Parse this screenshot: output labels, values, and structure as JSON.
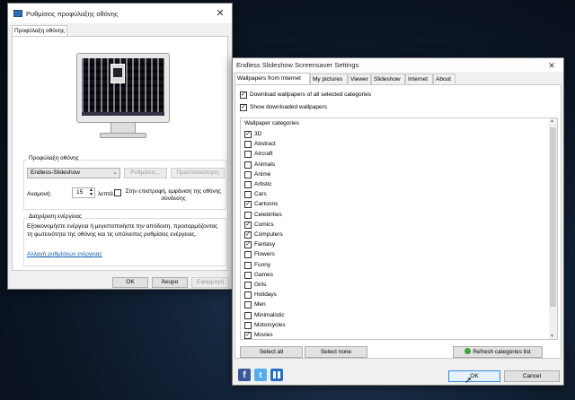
{
  "screensaver_dialog": {
    "title": "Ρυθμίσεις προφύλαξης οθόνης",
    "tab": "Προφύλαξη οθόνης",
    "group_label": "Προφύλαξη οθόνης",
    "selected_screensaver": "Endless-Slideshow",
    "settings_button": "Ρυθμίσεις...",
    "preview_button": "Προεπισκόπηση",
    "wait_label": "Αναμονή:",
    "wait_value": "15",
    "wait_unit": "λεπτά",
    "resume_checkbox_label": "Στην επιστροφή, εμφάνιση της οθόνης σύνδεσης",
    "power_group_label": "Διαχείριση ενέργειας",
    "power_text": "Εξοικονομήστε ενέργεια ή μεγιστοποιήστε την απόδοση, προσαρμόζοντας τη φωτεινότητα της οθόνης και τις υπόλοιπες ρυθμίσεις ενέργειας.",
    "power_link": "Αλλαγή ρυθμίσεων ενέργειας",
    "ok_button": "OK",
    "cancel_button": "Άκυρο",
    "apply_button": "Εφαρμογή"
  },
  "slideshow_dialog": {
    "title": "Endless Slideshow Screensaver Settings",
    "tabs": [
      "Wallpapers from Internet",
      "My pictures",
      "Viewer",
      "Slideshow",
      "Internet",
      "About"
    ],
    "download_all_label": "Download wallpapers of all selected categories",
    "download_all_checked": true,
    "show_downloaded_label": "Show downloaded wallpapers",
    "show_downloaded_checked": true,
    "categories_header": "Wallpaper categories",
    "categories": [
      {
        "name": "3D",
        "checked": true
      },
      {
        "name": "Abstract",
        "checked": false
      },
      {
        "name": "Aircraft",
        "checked": false
      },
      {
        "name": "Animals",
        "checked": false
      },
      {
        "name": "Anime",
        "checked": false
      },
      {
        "name": "Artistic",
        "checked": false
      },
      {
        "name": "Cars",
        "checked": false
      },
      {
        "name": "Cartoons",
        "checked": true
      },
      {
        "name": "Celebrities",
        "checked": false
      },
      {
        "name": "Comics",
        "checked": true
      },
      {
        "name": "Computers",
        "checked": true
      },
      {
        "name": "Fantasy",
        "checked": true
      },
      {
        "name": "Flowers",
        "checked": false
      },
      {
        "name": "Funny",
        "checked": false
      },
      {
        "name": "Games",
        "checked": false
      },
      {
        "name": "Girls",
        "checked": false
      },
      {
        "name": "Holidays",
        "checked": false
      },
      {
        "name": "Men",
        "checked": false
      },
      {
        "name": "Minimalistic",
        "checked": false
      },
      {
        "name": "Motorcycles",
        "checked": false
      },
      {
        "name": "Movies",
        "checked": true
      }
    ],
    "select_all_button": "Select all",
    "select_none_button": "Select none",
    "refresh_button": "Refresh categories list",
    "ok_button": "OK",
    "cancel_button": "Cancel",
    "social_icons": [
      "facebook-icon",
      "twitter-icon",
      "windows-live-icon"
    ]
  },
  "colors": {
    "link": "#0b5cad",
    "facebook": "#3b5998",
    "twitter": "#55acee",
    "refresh_icon": "#3aa43a"
  }
}
